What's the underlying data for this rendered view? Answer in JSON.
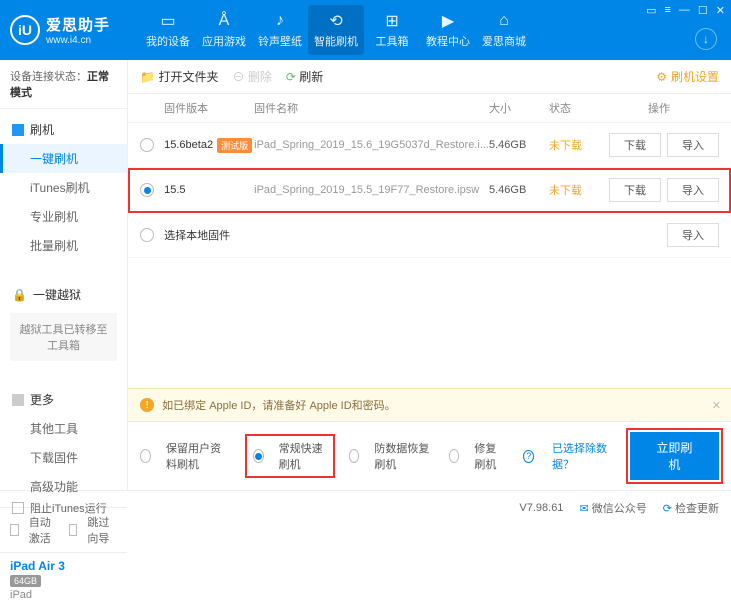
{
  "app": {
    "name": "爱思助手",
    "url": "www.i4.cn",
    "logo_letter": "iU"
  },
  "window_controls": [
    "▭",
    "≡",
    "—",
    "☐",
    "✕"
  ],
  "topnav": [
    {
      "icon": "▭",
      "label": "我的设备"
    },
    {
      "icon": "Å",
      "label": "应用游戏"
    },
    {
      "icon": "♪",
      "label": "铃声壁纸"
    },
    {
      "icon": "⟲",
      "label": "智能刷机"
    },
    {
      "icon": "⊞",
      "label": "工具箱"
    },
    {
      "icon": "▶",
      "label": "教程中心"
    },
    {
      "icon": "⌂",
      "label": "爱思商城"
    }
  ],
  "sidebar": {
    "status_label": "设备连接状态：",
    "status_value": "正常模式",
    "group1": {
      "title": "刷机",
      "items": [
        "一键刷机",
        "iTunes刷机",
        "专业刷机",
        "批量刷机"
      ]
    },
    "group2": {
      "title": "一键越狱",
      "note": "越狱工具已转移至工具箱"
    },
    "group3": {
      "title": "更多",
      "items": [
        "其他工具",
        "下载固件",
        "高级功能"
      ]
    },
    "activate": {
      "auto": "自动激活",
      "skip": "跳过向导"
    },
    "device": {
      "name": "iPad Air 3",
      "storage": "64GB",
      "type": "iPad"
    }
  },
  "toolbar": {
    "open_folder": "打开文件夹",
    "delete": "删除",
    "refresh": "刷新",
    "settings": "刷机设置"
  },
  "table": {
    "headers": {
      "version": "固件版本",
      "name": "固件名称",
      "size": "大小",
      "state": "状态",
      "ops": "操作"
    },
    "rows": [
      {
        "version": "15.6beta2",
        "beta_tag": "测试版",
        "name": "iPad_Spring_2019_15.6_19G5037d_Restore.i...",
        "size": "5.46GB",
        "state": "未下载",
        "selected": false
      },
      {
        "version": "15.5",
        "beta_tag": "",
        "name": "iPad_Spring_2019_15.5_19F77_Restore.ipsw",
        "size": "5.46GB",
        "state": "未下载",
        "selected": true
      }
    ],
    "local_label": "选择本地固件",
    "btn_download": "下载",
    "btn_import": "导入"
  },
  "alert": "如已绑定 Apple ID，请准备好 Apple ID和密码。",
  "options": {
    "o1": "保留用户资料刷机",
    "o2": "常规快速刷机",
    "o3": "防数据恢复刷机",
    "o4": "修复刷机",
    "link": "已选择除数据？",
    "action": "立即刷机"
  },
  "footer": {
    "block_itunes": "阻止iTunes运行",
    "version": "V7.98.61",
    "wechat": "微信公众号",
    "check_update": "检查更新"
  }
}
